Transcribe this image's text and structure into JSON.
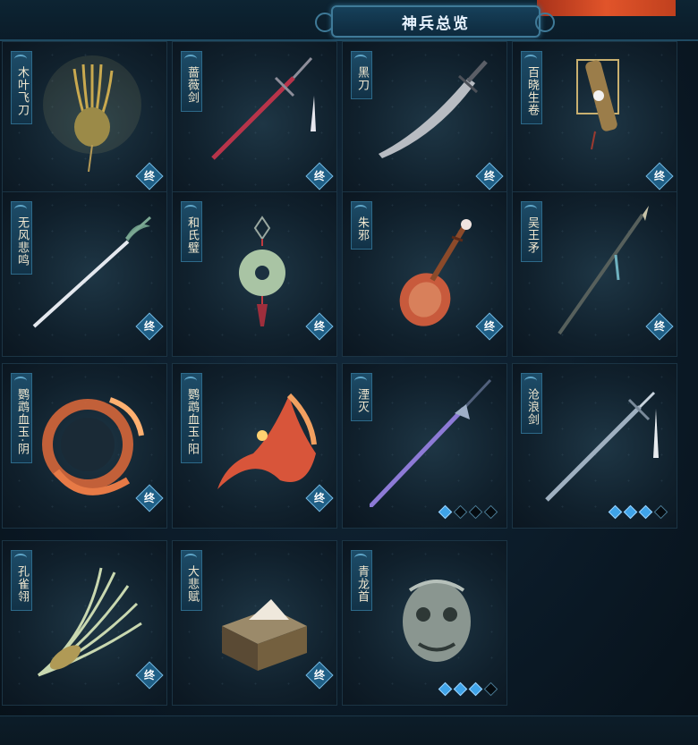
{
  "header": {
    "title": "神兵总览"
  },
  "colors": {
    "badge": "#1f5f86",
    "star_on": "#3fa3e8",
    "star_off": "#050b10"
  },
  "items": [
    {
      "name": "木叶飞刀",
      "badge": "终",
      "icon": "golden-flying-knives-icon"
    },
    {
      "name": "蔷薇剑",
      "badge": "终",
      "icon": "red-sword-icon"
    },
    {
      "name": "黑刀",
      "badge": "终",
      "icon": "black-blade-icon"
    },
    {
      "name": "百晓生卷",
      "badge": "终",
      "icon": "scroll-icon"
    },
    {
      "name": "无风悲鸣",
      "badge": "终",
      "icon": "silver-sword-icon"
    },
    {
      "name": "和氏璧",
      "badge": "终",
      "icon": "jade-disc-icon"
    },
    {
      "name": "朱邪",
      "badge": "终",
      "icon": "pipa-icon"
    },
    {
      "name": "吴王矛",
      "badge": "终",
      "icon": "spear-icon"
    },
    {
      "name": "鹦鹉血玉·阴",
      "badge": "终",
      "icon": "phoenix-icon"
    },
    {
      "name": "鹦鹉血玉·阳",
      "badge": "终",
      "icon": "phoenix-icon"
    },
    {
      "name": "湮灭",
      "stars": [
        1,
        0,
        0,
        0
      ],
      "icon": "violet-spear-icon"
    },
    {
      "name": "沧浪剑",
      "stars": [
        1,
        1,
        1,
        0
      ],
      "icon": "steel-sword-icon"
    },
    {
      "name": "孔雀翎",
      "badge": "终",
      "icon": "peacock-feather-icon"
    },
    {
      "name": "大悲赋",
      "badge": "终",
      "icon": "book-box-icon"
    },
    {
      "name": "青龙首",
      "stars": [
        1,
        1,
        1,
        0
      ],
      "icon": "dragon-head-icon"
    }
  ]
}
